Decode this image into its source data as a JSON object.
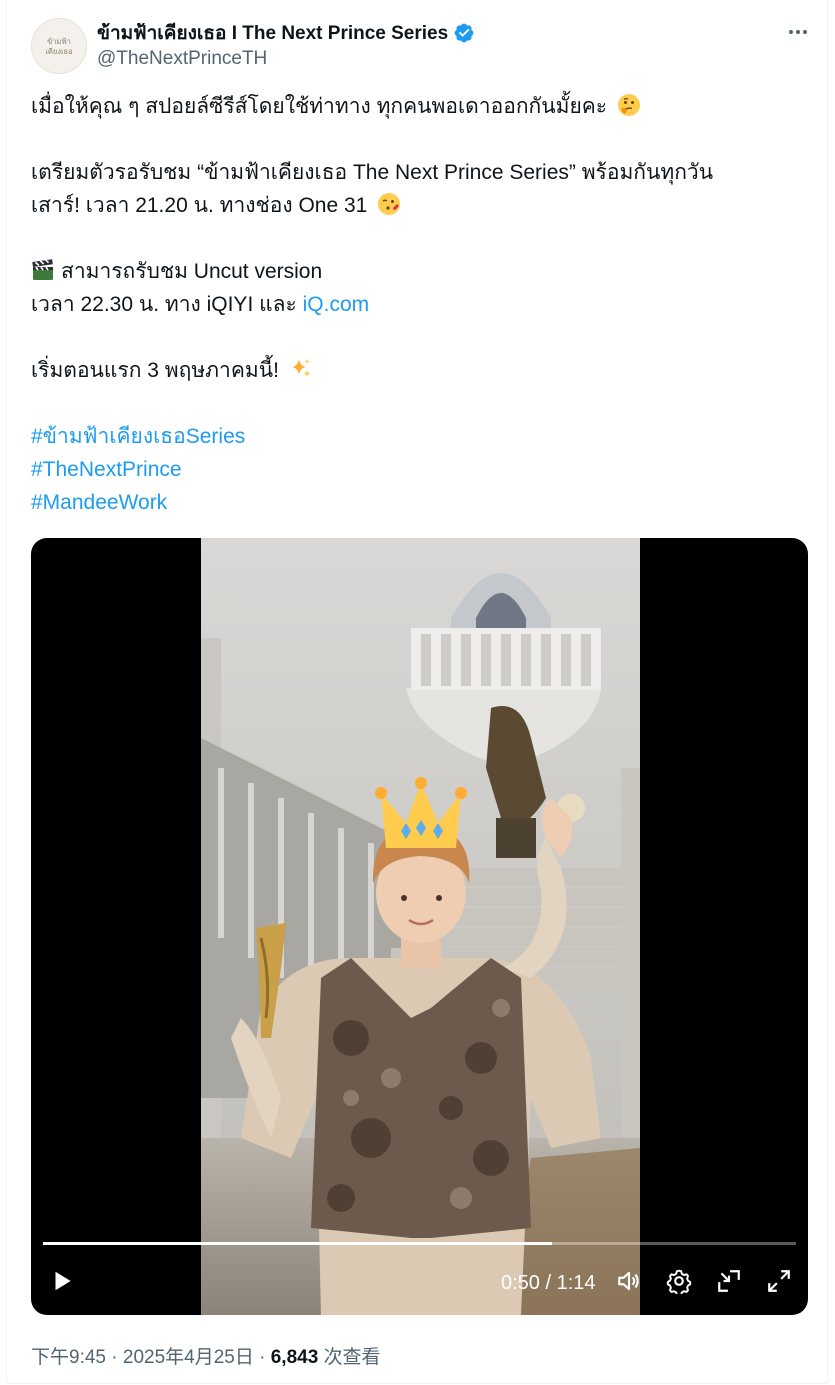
{
  "author": {
    "display_name": "ข้ามฟ้าเคียงเธอ I The Next Prince Series",
    "handle": "@TheNextPrinceTH",
    "avatar_text": "ข้ามฟ้า เคียงเธอ",
    "verified_icon": "verified-badge-icon"
  },
  "more_icon": "more-options-icon",
  "tweet": {
    "line1": "เมื่อให้คุณ ๆ สปอยล์ซีรีส์โดยใช้ท่าทาง ทุกคนพอเดาออกกันมั้ยคะ",
    "line2": "เตรียมตัวรอรับชม “ข้ามฟ้าเคียงเธอ The Next Prince Series” พร้อมกันทุกวัน",
    "line3": "เสาร์! เวลา 21.20 น. ทางช่อง One 31",
    "line4": "สามารถรับชม Uncut version",
    "line5_prefix": "เวลา 22.30 น. ทาง iQIYI และ ",
    "line5_link": "iQ.com",
    "line6": "เริ่มตอนแรก 3 พฤษภาคมนี้!",
    "hashtags": [
      "#ข้ามฟ้าเคียงเธอSeries",
      "#TheNextPrince",
      "#MandeeWork"
    ],
    "emojis": [
      "thinking-face",
      "face-blowing-kiss",
      "clapper-board",
      "sparkles"
    ]
  },
  "video": {
    "current_time": "0:50",
    "duration": "1:14",
    "time_display": "0:50 / 1:14",
    "progress": 0.676,
    "controls": [
      "play-icon",
      "volume-icon",
      "settings-icon",
      "minimize-icon",
      "fullscreen-icon"
    ]
  },
  "meta": {
    "time": "下午9:45",
    "separator": " · ",
    "date": "2025年4月25日",
    "views_count": "6,843",
    "views_label": " 次查看"
  },
  "colors": {
    "link": "#1d9bf0",
    "text": "#0f1419",
    "secondary": "#536471",
    "verified": "#1d9bf0"
  }
}
